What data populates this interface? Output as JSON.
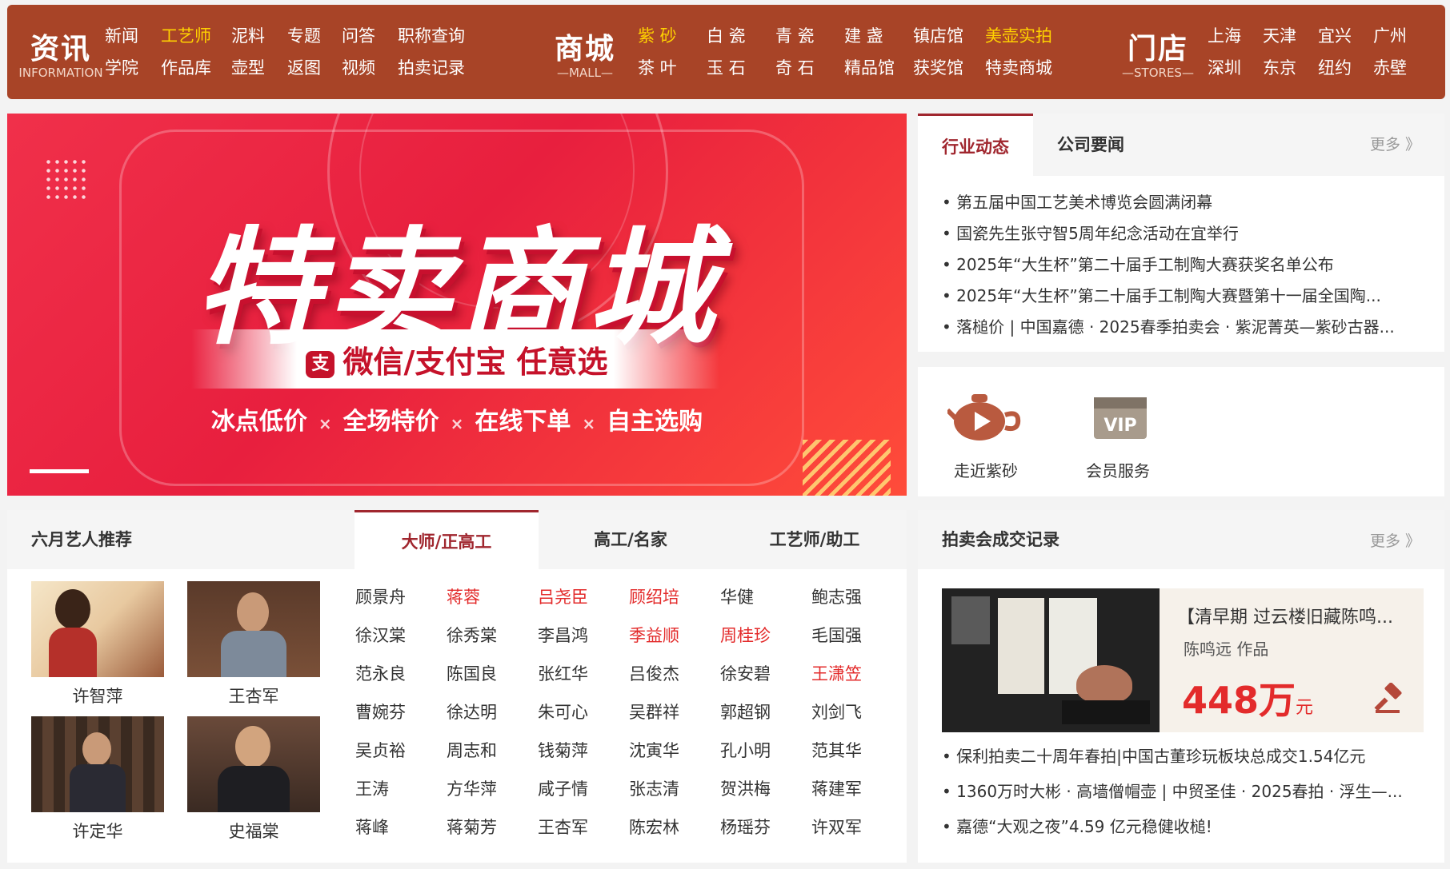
{
  "nav": {
    "info": {
      "title": "资讯",
      "sub": "INFORMATION",
      "links": [
        "新闻",
        "工艺师",
        "泥料",
        "专题",
        "问答",
        "职称查询",
        "学院",
        "作品库",
        "壶型",
        "返图",
        "视频",
        "拍卖记录"
      ],
      "highlight": [
        1
      ]
    },
    "mall": {
      "title": "商城",
      "sub": "—MALL—",
      "links": [
        "紫 砂",
        "白 瓷",
        "青 瓷",
        "建 盏",
        "镇店馆",
        "美壶实拍",
        "茶 叶",
        "玉 石",
        "奇 石",
        "精品馆",
        "获奖馆",
        "特卖商城"
      ],
      "highlight": [
        0,
        5
      ]
    },
    "stores": {
      "title": "门店",
      "sub": "—STORES—",
      "links": [
        "上海",
        "天津",
        "宜兴",
        "广州",
        "深圳",
        "东京",
        "纽约",
        "赤壁"
      ]
    }
  },
  "banner": {
    "title": "特卖商城",
    "subtitle": "微信/支付宝 任意选",
    "tags": [
      "冰点低价",
      "全场特价",
      "在线下单",
      "自主选购"
    ],
    "sep": "×"
  },
  "news": {
    "tabs": [
      "行业动态",
      "公司要闻"
    ],
    "more": "更多 》",
    "items": [
      "第五届中国工艺美术博览会圆满闭幕",
      "国瓷先生张守智5周年纪念活动在宜举行",
      "2025年“大生杯”第二十届手工制陶大赛获奖名单公布",
      "2025年“大生杯”第二十届手工制陶大赛暨第十一届全国陶...",
      "落槌价 | 中国嘉德 · 2025春季拍卖会 · 紫泥菁英—紫砂古器..."
    ]
  },
  "services": [
    {
      "label": "走近紫砂",
      "icon": "teapot-play-icon"
    },
    {
      "label": "会员服务",
      "icon": "vip-icon"
    }
  ],
  "artists": {
    "title": "六月艺人推荐",
    "tabs": [
      "大师/正高工",
      "高工/名家",
      "工艺师/助工"
    ],
    "featured": [
      "许智萍",
      "王杏军",
      "许定华",
      "史福棠"
    ],
    "names": [
      {
        "n": "顾景舟",
        "r": false
      },
      {
        "n": "蒋蓉",
        "r": true
      },
      {
        "n": "吕尧臣",
        "r": true
      },
      {
        "n": "顾绍培",
        "r": true
      },
      {
        "n": "华健",
        "r": false
      },
      {
        "n": "鲍志强",
        "r": false
      },
      {
        "n": "徐汉棠",
        "r": false
      },
      {
        "n": "徐秀棠",
        "r": false
      },
      {
        "n": "李昌鸿",
        "r": false
      },
      {
        "n": "季益顺",
        "r": true
      },
      {
        "n": "周桂珍",
        "r": true
      },
      {
        "n": "毛国强",
        "r": false
      },
      {
        "n": "范永良",
        "r": false
      },
      {
        "n": "陈国良",
        "r": false
      },
      {
        "n": "张红华",
        "r": false
      },
      {
        "n": "吕俊杰",
        "r": false
      },
      {
        "n": "徐安碧",
        "r": false
      },
      {
        "n": "王潇笠",
        "r": true
      },
      {
        "n": "曹婉芬",
        "r": false
      },
      {
        "n": "徐达明",
        "r": false
      },
      {
        "n": "朱可心",
        "r": false
      },
      {
        "n": "吴群祥",
        "r": false
      },
      {
        "n": "郭超钢",
        "r": false
      },
      {
        "n": "刘剑飞",
        "r": false
      },
      {
        "n": "吴贞裕",
        "r": false
      },
      {
        "n": "周志和",
        "r": false
      },
      {
        "n": "钱菊萍",
        "r": false
      },
      {
        "n": "沈寅华",
        "r": false
      },
      {
        "n": "孔小明",
        "r": false
      },
      {
        "n": "范其华",
        "r": false
      },
      {
        "n": "王涛",
        "r": false
      },
      {
        "n": "方华萍",
        "r": false
      },
      {
        "n": "咸子情",
        "r": false
      },
      {
        "n": "张志清",
        "r": false
      },
      {
        "n": "贺洪梅",
        "r": false
      },
      {
        "n": "蒋建军",
        "r": false
      },
      {
        "n": "蒋峰",
        "r": false
      },
      {
        "n": "蒋菊芳",
        "r": false
      },
      {
        "n": "王杏军",
        "r": false
      },
      {
        "n": "陈宏林",
        "r": false
      },
      {
        "n": "杨瑶芬",
        "r": false
      },
      {
        "n": "许双军",
        "r": false
      }
    ]
  },
  "auction": {
    "title": "拍卖会成交记录",
    "more": "更多 》",
    "lot_title": "【清早期 过云楼旧藏陈鸣...",
    "maker": "陈鸣远 作品",
    "price": "448万",
    "unit": "元",
    "items": [
      "保利拍卖二十周年春拍|中国古董珍玩板块总成交1.54亿元",
      "1360万时大彬 · 高墙僧帽壶 | 中贸圣佳 · 2025春拍 · 浮生—...",
      "嘉德“大观之夜”4.59 亿元稳健收槌!"
    ]
  },
  "colors": {
    "nav_bg": "#a84427",
    "accent": "#a0262e",
    "highlight": "#ffd200",
    "red_name": "#e32b2b"
  }
}
